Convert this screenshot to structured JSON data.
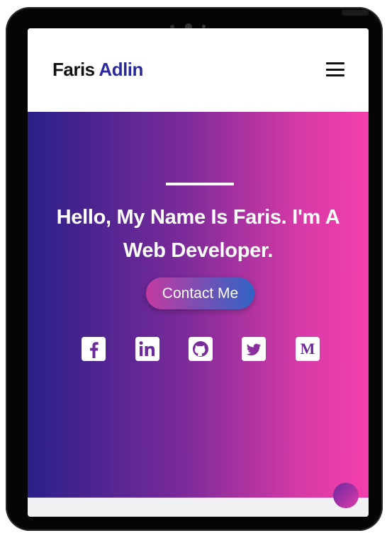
{
  "header": {
    "logo_first": "Faris",
    "logo_last": "Adlin",
    "menu_icon": "hamburger-menu-icon"
  },
  "hero": {
    "title": "Hello, My Name Is Faris. I'm A Web Developer.",
    "cta_label": "Contact Me",
    "gradient_colors": [
      "#2a2088",
      "#7a2a9a",
      "#d63aa6",
      "#f43fac"
    ],
    "social": [
      {
        "icon": "facebook-icon"
      },
      {
        "icon": "linkedin-icon"
      },
      {
        "icon": "github-icon"
      },
      {
        "icon": "twitter-icon"
      },
      {
        "icon": "medium-icon",
        "glyph": "M"
      }
    ]
  },
  "colors": {
    "logo_first": "#111111",
    "logo_last": "#2a2a9e",
    "button_gradient": [
      "#c43aa0",
      "#2f64c6"
    ]
  }
}
